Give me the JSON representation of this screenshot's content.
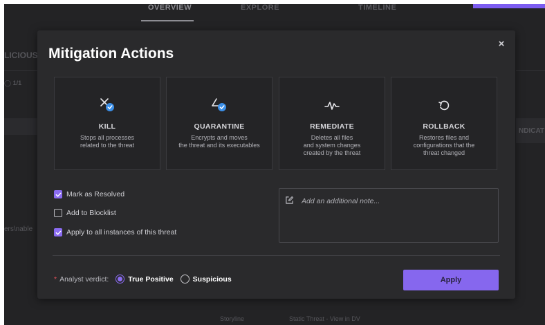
{
  "nav": {
    "tabs": [
      "OVERVIEW",
      "EXPLORE",
      "TIMELINE"
    ]
  },
  "background": {
    "malicious_label": "LICIOUS",
    "count_label": "1/1",
    "indicators_label": "NDICAT",
    "path_fragment": "ers\\nable",
    "storyline_label": "Storyline",
    "static_threat": "Static Threat - View in DV"
  },
  "modal": {
    "title": "Mitigation Actions",
    "close_symbol": "×",
    "actions": [
      {
        "title": "KILL",
        "desc_lines": [
          "Stops all processes",
          "related to the threat"
        ]
      },
      {
        "title": "QUARANTINE",
        "desc_lines": [
          "Encrypts and moves",
          "the threat and its executables"
        ]
      },
      {
        "title": "REMEDIATE",
        "desc_lines": [
          "Deletes all files",
          "and system changes",
          "created by the threat"
        ]
      },
      {
        "title": "ROLLBACK",
        "desc_lines": [
          "Restores files and",
          "configurations that the",
          "threat changed"
        ]
      }
    ],
    "options": [
      {
        "label": "Mark as Resolved",
        "checked": true
      },
      {
        "label": "Add to Blocklist",
        "checked": false
      },
      {
        "label": "Apply to all instances of this threat",
        "checked": true
      }
    ],
    "note": {
      "placeholder": "Add an additional note...",
      "value": ""
    },
    "verdict": {
      "required_mark": "*",
      "label": "Analyst verdict:",
      "options": [
        {
          "label": "True Positive",
          "selected": true
        },
        {
          "label": "Suspicious",
          "selected": false
        }
      ]
    },
    "apply_label": "Apply"
  },
  "colors": {
    "accent": "#8b6cf2",
    "badge_blue": "#3b8fe8",
    "modal_bg": "#2a2a2c"
  },
  "icons": {
    "kill": "x-with-check-badge-icon",
    "quarantine": "triangle-with-check-badge-icon",
    "remediate": "pulse-icon",
    "rollback": "rotate-ccw-icon",
    "note": "edit-note-icon"
  }
}
